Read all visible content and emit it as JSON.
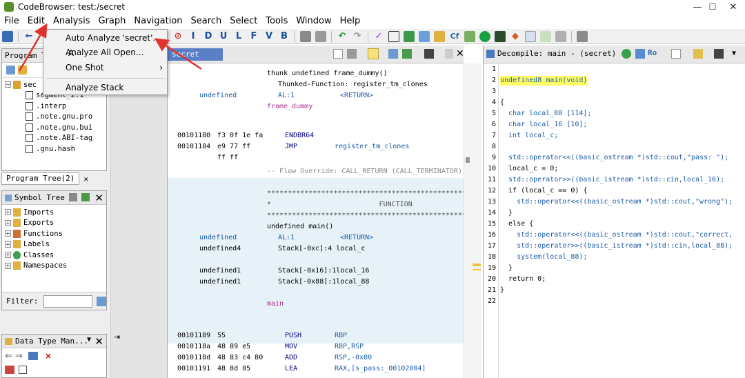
{
  "window": {
    "title": "CodeBrowser: test:/secret"
  },
  "menubar": [
    "File",
    "Edit",
    "Analysis",
    "Graph",
    "Navigation",
    "Search",
    "Select",
    "Tools",
    "Window",
    "Help"
  ],
  "toolbar_letters": [
    "I",
    "D",
    "U",
    "L",
    "F",
    "V",
    "B"
  ],
  "analysis_menu": {
    "items": [
      {
        "label": "Auto Analyze 'secret'...",
        "shortcut": "A"
      },
      {
        "label": "Analyze All Open..."
      },
      {
        "label": "One Shot",
        "submenu": "›"
      },
      {
        "label": "Analyze Stack"
      }
    ]
  },
  "program_tree": {
    "tab_label": "Program T",
    "tab2_label": "Program Tree(2)",
    "root": "sec",
    "items": [
      "segment_2.1",
      ".interp",
      ".note.gnu.pro",
      ".note.gnu.bui",
      ".note.ABI-tag",
      ".gnu.hash"
    ]
  },
  "symbol_tree": {
    "title": "Symbol Tree",
    "items": [
      "Imports",
      "Exports",
      "Functions",
      "Labels",
      "Classes",
      "Namespaces"
    ],
    "filter_label": "Filter:"
  },
  "data_type_manager": {
    "title": "Data Type Man..."
  },
  "listing": {
    "tab_label": "secret",
    "lines": {
      "thunk": "thunk undefined frame_dummy()",
      "thunked": "Thunked-Function: register_tm_clones",
      "al_type": "undefined",
      "al_name": "AL:1",
      "al_ret": "<RETURN>",
      "frame_label": "frame_dummy",
      "a1_addr": "00101180",
      "a1_bytes": "f3 0f 1e fa",
      "a1_mn": "ENDBR64",
      "a2_addr": "00101184",
      "a2_bytes": "e9 77 ff",
      "a2_mn": "JMP",
      "a2_op": "register_tm_clones",
      "a2_bytes2": "ff ff",
      "flow": "-- Flow Override: CALL_RETURN (CALL_TERMINATOR)",
      "stars1": "**************************************************************",
      "func_line": "*                          FUNCTION",
      "stars2": "**************************************************************",
      "main_sig": "undefined main()",
      "m_al_type": "undefined",
      "m_al_name": "AL:1",
      "m_al_ret": "<RETURN>",
      "v1_type": "undefined4",
      "v1_loc": "Stack[-0xc]:4 local_c",
      "v2_type": "undefined1",
      "v2_loc": "Stack[-0x16]:1local_16",
      "v3_type": "undefined1",
      "v3_loc": "Stack[-0x88]:1local_88",
      "main_label": "main",
      "i1_addr": "00101189",
      "i1_bytes": "55",
      "i1_mn": "PUSH",
      "i1_op": "RBP",
      "i2_addr": "0010118a",
      "i2_bytes": "48 89 e5",
      "i2_mn": "MOV",
      "i2_op": "RBP,RSP",
      "i3_addr": "0010118d",
      "i3_bytes": "48 83 c4 80",
      "i3_mn": "ADD",
      "i3_op": "RSP,-0x80",
      "i4_addr": "00101191",
      "i4_bytes": "48 8d 05",
      "i4_mn": "LEA",
      "i4_op": "RAX,[s_pass:_00102004]"
    }
  },
  "decompile": {
    "title": "Decompile: main -  (secret)",
    "line_numbers": [
      "1",
      "2",
      "3",
      "4",
      "5",
      "6",
      "7",
      "8",
      "9",
      "10",
      "11",
      "12",
      "13",
      "14",
      "15",
      "16",
      "17",
      "18",
      "19",
      "20",
      "21",
      "22"
    ],
    "code": [
      "",
      "undefined8 main(void)",
      "",
      "{",
      "  char local_88 [114];",
      "  char local_16 [10];",
      "  int local_c;",
      "",
      "  std::operator<<((basic_ostream *)std::cout,\"pass: \");",
      "  local_c = 0;",
      "  std::operator>>((basic_istream *)std::cin,local_16);",
      "  if (local_c == 0) {",
      "    std::operator<<((basic_ostream *)std::cout,\"wrong\");",
      "  }",
      "  else {",
      "    std::operator<<((basic_ostream *)std::cout,\"correct,",
      "    std::operator>>((basic_istream *)std::cin,local_88);",
      "    system(local_88);",
      "  }",
      "  return 0;",
      "}",
      ""
    ]
  },
  "colors": {
    "accent_blue": "#5b7fc7",
    "arrow_red": "#e0322d",
    "highlight_band": "#e6f1f8"
  }
}
